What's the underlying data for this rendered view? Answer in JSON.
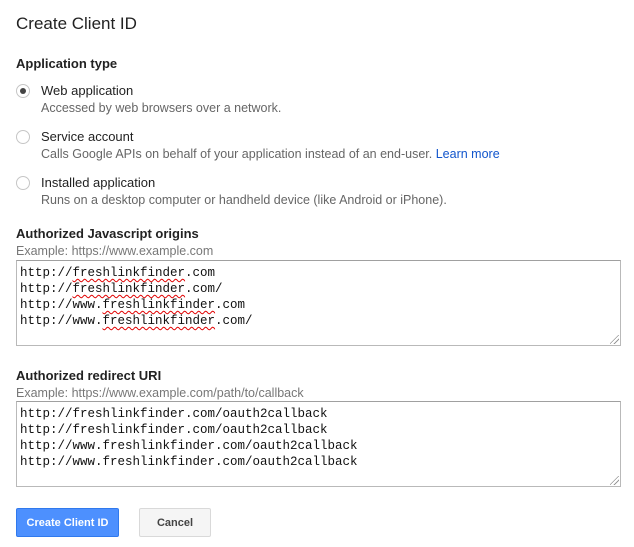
{
  "dialog": {
    "title": "Create Client ID"
  },
  "application_type": {
    "label": "Application type",
    "options": [
      {
        "label": "Web application",
        "description": "Accessed by web browsers over a network.",
        "selected": true
      },
      {
        "label": "Service account",
        "description": "Calls Google APIs on behalf of your application instead of an end-user.",
        "link": "Learn more",
        "selected": false
      },
      {
        "label": "Installed application",
        "description": "Runs on a desktop computer or handheld device (like Android or iPhone).",
        "selected": false
      }
    ]
  },
  "js_origins": {
    "label": "Authorized Javascript origins",
    "example": "Example: https://www.example.com",
    "lines": [
      {
        "prefix": "http://",
        "word": "freshlinkfinder",
        "suffix": ".com"
      },
      {
        "prefix": "http://",
        "word": "freshlinkfinder",
        "suffix": ".com/"
      },
      {
        "prefix": "http://www.",
        "word": "freshlinkfinder",
        "suffix": ".com"
      },
      {
        "prefix": "http://www.",
        "word": "freshlinkfinder",
        "suffix": ".com/"
      }
    ]
  },
  "redirect_uris": {
    "label": "Authorized redirect URI",
    "example": "Example: https://www.example.com/path/to/callback",
    "lines": [
      "http://freshlinkfinder.com/oauth2callback",
      "http://freshlinkfinder.com/oauth2callback",
      "http://www.freshlinkfinder.com/oauth2callback",
      "http://www.freshlinkfinder.com/oauth2callback"
    ]
  },
  "buttons": {
    "create": "Create Client ID",
    "cancel": "Cancel"
  },
  "colors": {
    "primary": "#4d90fe",
    "link": "#1155cc",
    "spellcheck": "#e00000"
  }
}
